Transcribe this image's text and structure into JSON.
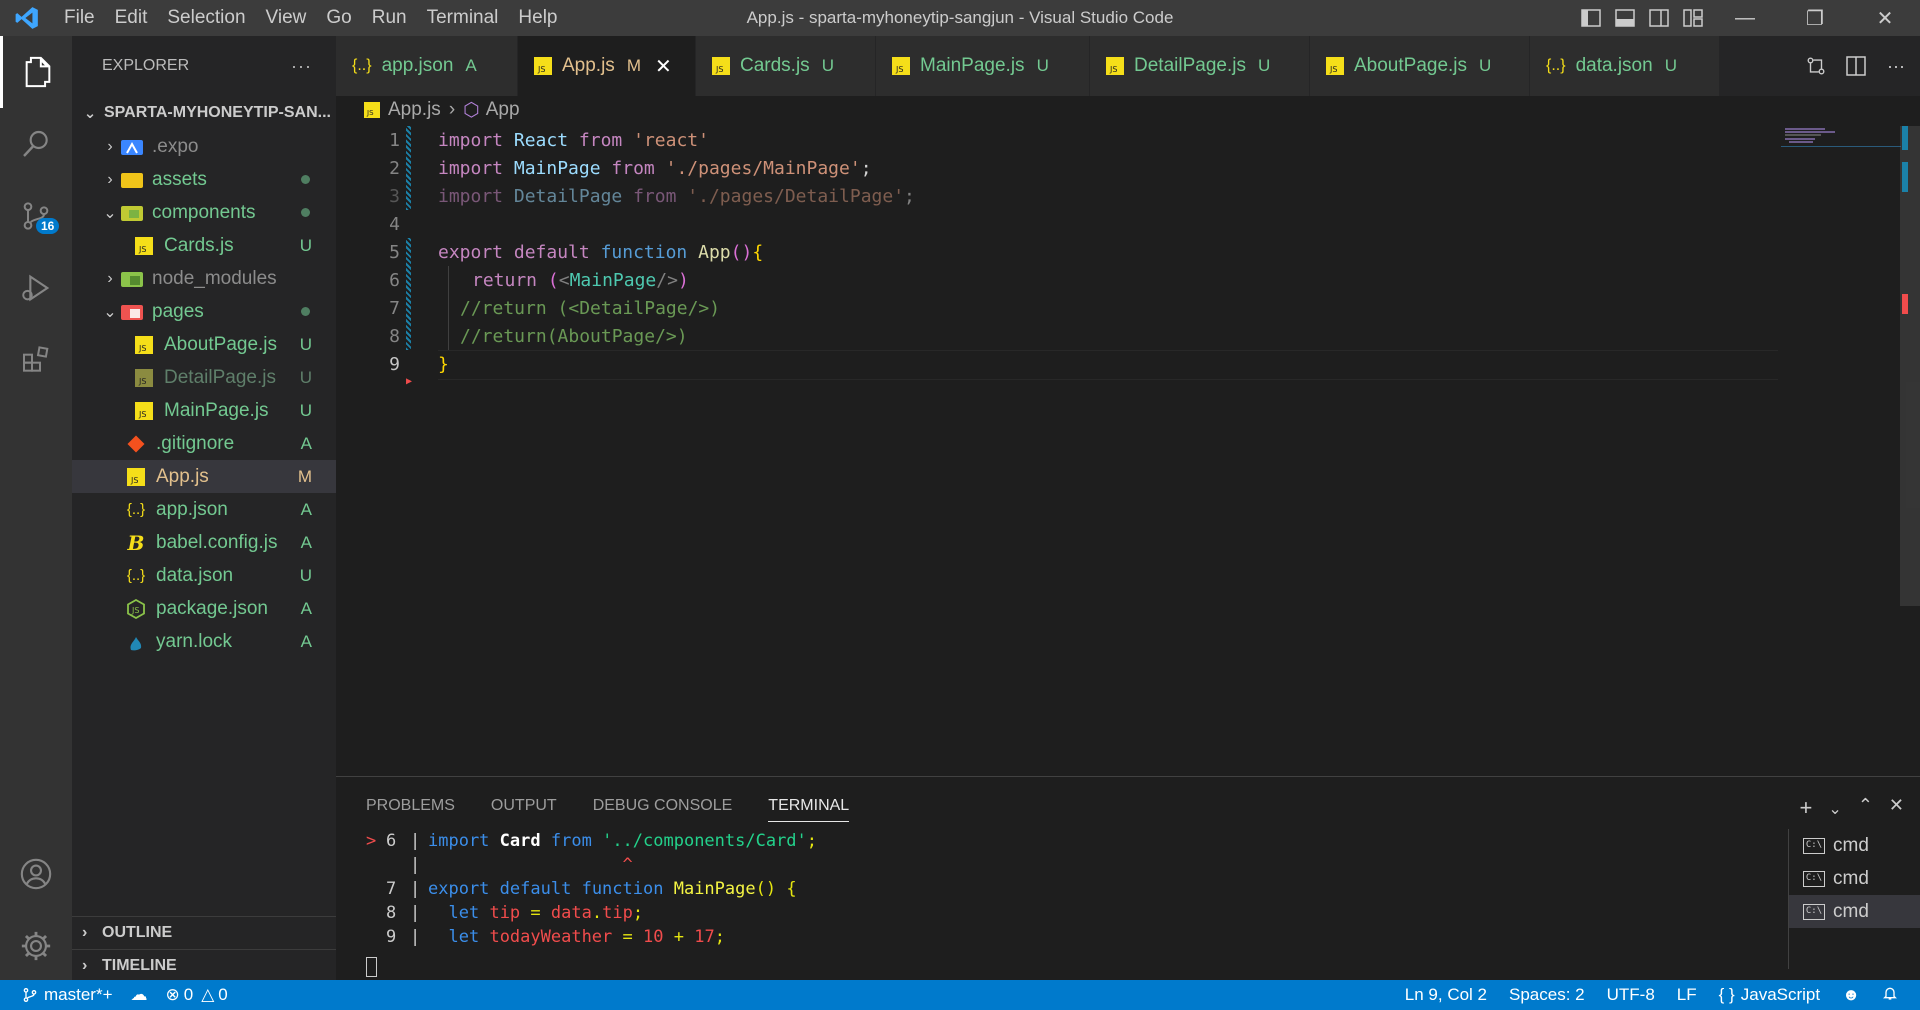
{
  "window": {
    "title": "App.js - sparta-myhoneytip-sangjun - Visual Studio Code",
    "menu": [
      "File",
      "Edit",
      "Selection",
      "View",
      "Go",
      "Run",
      "Terminal",
      "Help"
    ]
  },
  "activity_bar": {
    "items": [
      "explorer-icon",
      "search-icon",
      "source-control-icon",
      "run-debug-icon",
      "extensions-icon"
    ],
    "source_control_badge": "16",
    "bottom": [
      "account-icon",
      "settings-gear-icon"
    ]
  },
  "explorer": {
    "title": "EXPLORER",
    "more": "···",
    "project": "SPARTA-MYHONEYTIP-SAN...",
    "tree": [
      {
        "label": ".expo",
        "status": "",
        "kind": "folder-expo"
      },
      {
        "label": "assets",
        "status": "",
        "kind": "folder-assets"
      },
      {
        "label": "components",
        "status": "",
        "kind": "folder-components"
      },
      {
        "label": "Cards.js",
        "status": "U",
        "kind": "js"
      },
      {
        "label": "node_modules",
        "status": "",
        "kind": "folder-node"
      },
      {
        "label": "pages",
        "status": "",
        "kind": "folder-pages"
      },
      {
        "label": "AboutPage.js",
        "status": "U",
        "kind": "js"
      },
      {
        "label": "DetailPage.js",
        "status": "U",
        "kind": "js"
      },
      {
        "label": "MainPage.js",
        "status": "U",
        "kind": "js"
      },
      {
        "label": ".gitignore",
        "status": "A",
        "kind": "git"
      },
      {
        "label": "App.js",
        "status": "M",
        "kind": "js"
      },
      {
        "label": "app.json",
        "status": "A",
        "kind": "json"
      },
      {
        "label": "babel.config.js",
        "status": "A",
        "kind": "babel"
      },
      {
        "label": "data.json",
        "status": "U",
        "kind": "json"
      },
      {
        "label": "package.json",
        "status": "A",
        "kind": "node"
      },
      {
        "label": "yarn.lock",
        "status": "A",
        "kind": "yarn"
      }
    ],
    "outline": "OUTLINE",
    "timeline": "TIMELINE"
  },
  "tabs": [
    {
      "label": "app.json",
      "status": "A",
      "icon": "{..}"
    },
    {
      "label": "App.js",
      "status": "M",
      "icon": "JS"
    },
    {
      "label": "Cards.js",
      "status": "U",
      "icon": "JS"
    },
    {
      "label": "MainPage.js",
      "status": "U",
      "icon": "JS"
    },
    {
      "label": "DetailPage.js",
      "status": "U",
      "icon": "JS"
    },
    {
      "label": "AboutPage.js",
      "status": "U",
      "icon": "JS"
    },
    {
      "label": "data.json",
      "status": "U",
      "icon": "{..}"
    }
  ],
  "breadcrumb": {
    "file": "App.js",
    "symbol": "App"
  },
  "editor": {
    "line_numbers": [
      "1",
      "2",
      "3",
      "4",
      "5",
      "6",
      "7",
      "8",
      "9"
    ],
    "lines": [
      [
        "import",
        " ",
        "React",
        " ",
        "from",
        " ",
        "'react'"
      ],
      [
        "import",
        " ",
        "MainPage",
        " ",
        "from",
        " ",
        "'./pages/MainPage'",
        ";"
      ],
      [
        "import",
        " ",
        "DetailPage",
        " ",
        "from",
        " ",
        "'./pages/DetailPage'",
        ";"
      ],
      [],
      [
        "export",
        " ",
        "default",
        " ",
        "function",
        " ",
        "App",
        "()",
        "{"
      ],
      [
        "return",
        " ",
        "(",
        "<",
        "MainPage",
        "/>",
        ")"
      ],
      [
        "//return (<DetailPage/>)"
      ],
      [
        "//return(AboutPage/>)"
      ],
      [
        "}"
      ]
    ]
  },
  "panel": {
    "tabs": [
      "PROBLEMS",
      "OUTPUT",
      "DEBUG CONSOLE",
      "TERMINAL"
    ],
    "terminal_lines": [
      {
        "marker": ">",
        "num": "6",
        "pipe": "|",
        "parts": [
          "import",
          " ",
          "Card",
          " ",
          "from",
          " ",
          "'../components/Card'",
          ";"
        ]
      },
      {
        "marker": "",
        "num": "",
        "pipe": "|",
        "parts": [
          "                   ",
          "^"
        ]
      },
      {
        "marker": "",
        "num": "7",
        "pipe": "|",
        "parts": [
          "export",
          " ",
          "default",
          " ",
          "function",
          " ",
          "MainPage",
          "()",
          " ",
          "{"
        ]
      },
      {
        "marker": "",
        "num": "8",
        "pipe": "|",
        "parts": [
          "  ",
          "let",
          " ",
          "tip",
          " = ",
          "data",
          ".",
          "tip",
          ";"
        ]
      },
      {
        "marker": "",
        "num": "9",
        "pipe": "|",
        "parts": [
          "  ",
          "let",
          " ",
          "todayWeather",
          " = ",
          "10",
          " + ",
          "17",
          ";"
        ]
      }
    ],
    "terminals": [
      "cmd",
      "cmd",
      "cmd"
    ]
  },
  "status_bar": {
    "branch": "master*+",
    "errors": "0",
    "warnings": "0",
    "position": "Ln 9, Col 2",
    "spaces": "Spaces: 2",
    "encoding": "UTF-8",
    "eol": "LF",
    "language": "JavaScript"
  },
  "colors": {
    "accent": "#007acc",
    "untracked": "#73c991",
    "modified": "#e2c08d",
    "js_icon": "#f5de19"
  }
}
